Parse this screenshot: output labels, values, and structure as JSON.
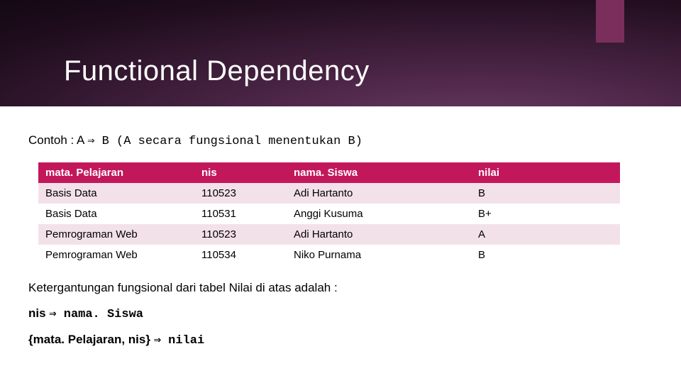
{
  "title": "Functional Dependency",
  "intro": {
    "prefix": "Contoh : A ",
    "arrow": "⇒",
    "rest": " B (A secara fungsional menentukan B)"
  },
  "table": {
    "headers": [
      "mata. Pelajaran",
      "nis",
      "nama. Siswa",
      "nilai"
    ],
    "rows": [
      [
        "Basis Data",
        "110523",
        "Adi Hartanto",
        "B"
      ],
      [
        "Basis Data",
        "110531",
        "Anggi Kusuma",
        "B+"
      ],
      [
        "Pemrograman Web",
        "110523",
        "Adi Hartanto",
        "A"
      ],
      [
        "Pemrograman Web",
        "110534",
        "Niko Purnama",
        "B"
      ]
    ]
  },
  "after_text": "Ketergantungan fungsional dari tabel Nilai di atas adalah :",
  "fd1": {
    "left": "nis ",
    "arrow": "⇒",
    "right": " nama. Siswa"
  },
  "fd2": {
    "left": "{mata. Pelajaran, nis} ",
    "arrow": "⇒",
    "right": " nilai"
  },
  "chart_data": {
    "type": "table",
    "title": "Functional Dependency example (tabel Nilai)",
    "columns": [
      "mata.Pelajaran",
      "nis",
      "nama.Siswa",
      "nilai"
    ],
    "rows": [
      {
        "mata.Pelajaran": "Basis Data",
        "nis": 110523,
        "nama.Siswa": "Adi Hartanto",
        "nilai": "B"
      },
      {
        "mata.Pelajaran": "Basis Data",
        "nis": 110531,
        "nama.Siswa": "Anggi Kusuma",
        "nilai": "B+"
      },
      {
        "mata.Pelajaran": "Pemrograman Web",
        "nis": 110523,
        "nama.Siswa": "Adi Hartanto",
        "nilai": "A"
      },
      {
        "mata.Pelajaran": "Pemrograman Web",
        "nis": 110534,
        "nama.Siswa": "Niko Purnama",
        "nilai": "B"
      }
    ],
    "functional_dependencies": [
      "nis ⇒ nama.Siswa",
      "{mata.Pelajaran, nis} ⇒ nilai"
    ]
  }
}
